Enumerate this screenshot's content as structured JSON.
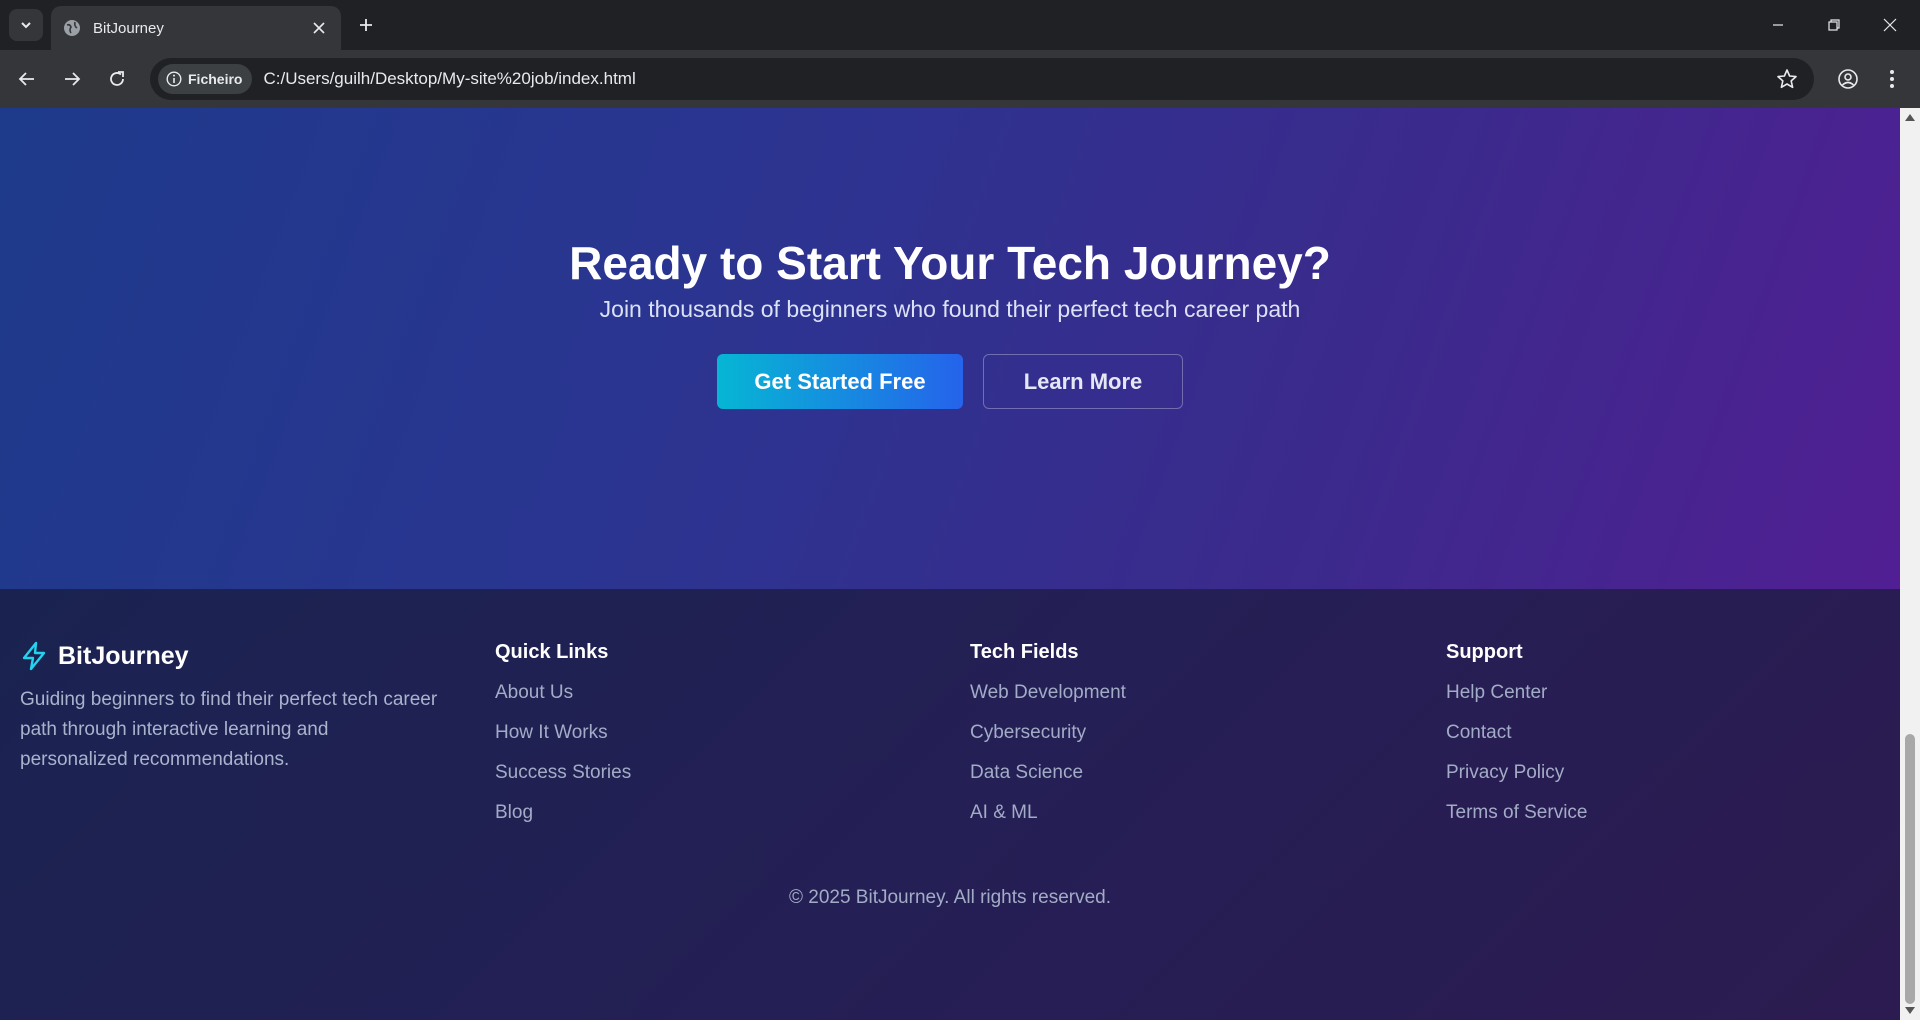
{
  "browser": {
    "tab_title": "BitJourney",
    "security_chip": "Ficheiro",
    "url": "C:/Users/guilh/Desktop/My-site%20job/index.html"
  },
  "cta": {
    "title": "Ready to Start Your Tech Journey?",
    "subtitle": "Join thousands of beginners who found their perfect tech career path",
    "primary_button": "Get Started Free",
    "secondary_button": "Learn More"
  },
  "footer": {
    "brand_name": "BitJourney",
    "brand_description": "Guiding beginners to find their perfect tech career path through interactive learning and personalized recommendations.",
    "columns": [
      {
        "title": "Quick Links",
        "links": [
          "About Us",
          "How It Works",
          "Success Stories",
          "Blog"
        ]
      },
      {
        "title": "Tech Fields",
        "links": [
          "Web Development",
          "Cybersecurity",
          "Data Science",
          "AI & ML"
        ]
      },
      {
        "title": "Support",
        "links": [
          "Help Center",
          "Contact",
          "Privacy Policy",
          "Terms of Service"
        ]
      }
    ],
    "copyright": "© 2025 BitJourney. All rights reserved."
  },
  "colors": {
    "accent_cyan": "#06b6d4",
    "accent_blue": "#2563eb",
    "brand_icon": "#22d3ee"
  },
  "icons": [
    "tab-search-icon",
    "globe-icon",
    "close-icon",
    "plus-icon",
    "minimize-icon",
    "restore-icon",
    "back-arrow-icon",
    "forward-arrow-icon",
    "reload-icon",
    "info-icon",
    "star-icon",
    "profile-icon",
    "kebab-menu-icon",
    "lightning-bolt-icon"
  ]
}
